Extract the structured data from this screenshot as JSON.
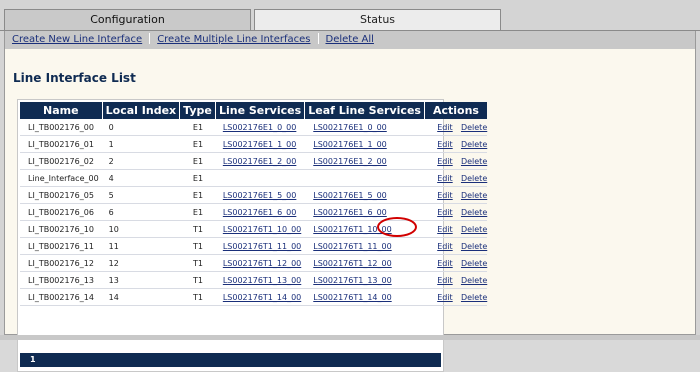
{
  "tabs": [
    {
      "label": "Configuration",
      "active": true
    },
    {
      "label": "Status",
      "active": false
    }
  ],
  "toolbar": {
    "links": [
      "Create New Line Interface",
      "Create Multiple Line Interfaces",
      "Delete All"
    ]
  },
  "page_title": "Line Interface List",
  "table": {
    "headers": [
      "Name",
      "Local Index",
      "Type",
      "Line Services",
      "Leaf Line Services",
      "Actions"
    ],
    "rows": [
      {
        "name": "LI_TB002176_00",
        "index": "0",
        "type": "E1",
        "ls": "LS002176E1_0_00",
        "lls": "LS002176E1_0_00",
        "edit": "Edit",
        "delete": "Delete"
      },
      {
        "name": "LI_TB002176_01",
        "index": "1",
        "type": "E1",
        "ls": "LS002176E1_1_00",
        "lls": "LS002176E1_1_00",
        "edit": "Edit",
        "delete": "Delete"
      },
      {
        "name": "LI_TB002176_02",
        "index": "2",
        "type": "E1",
        "ls": "LS002176E1_2_00",
        "lls": "LS002176E1_2_00",
        "edit": "Edit",
        "delete": "Delete"
      },
      {
        "name": "Line_Interface_00",
        "index": "4",
        "type": "E1",
        "ls": "",
        "lls": "",
        "edit": "Edit",
        "delete": "Delete"
      },
      {
        "name": "LI_TB002176_05",
        "index": "5",
        "type": "E1",
        "ls": "LS002176E1_5_00",
        "lls": "LS002176E1_5_00",
        "edit": "Edit",
        "delete": "Delete"
      },
      {
        "name": "LI_TB002176_06",
        "index": "6",
        "type": "E1",
        "ls": "LS002176E1_6_00",
        "lls": "LS002176E1_6_00",
        "edit": "Edit",
        "delete": "Delete"
      },
      {
        "name": "LI_TB002176_10",
        "index": "10",
        "type": "T1",
        "ls": "LS002176T1_10_00",
        "lls": "LS002176T1_10_00",
        "edit": "Edit",
        "delete": "Delete"
      },
      {
        "name": "LI_TB002176_11",
        "index": "11",
        "type": "T1",
        "ls": "LS002176T1_11_00",
        "lls": "LS002176T1_11_00",
        "edit": "Edit",
        "delete": "Delete"
      },
      {
        "name": "LI_TB002176_12",
        "index": "12",
        "type": "T1",
        "ls": "LS002176T1_12_00",
        "lls": "LS002176T1_12_00",
        "edit": "Edit",
        "delete": "Delete"
      },
      {
        "name": "LI_TB002176_13",
        "index": "13",
        "type": "T1",
        "ls": "LS002176T1_13_00",
        "lls": "LS002176T1_13_00",
        "edit": "Edit",
        "delete": "Delete"
      },
      {
        "name": "LI_TB002176_14",
        "index": "14",
        "type": "T1",
        "ls": "LS002176T1_14_00",
        "lls": "LS002176T1_14_00",
        "edit": "Edit",
        "delete": "Delete"
      }
    ]
  },
  "pagination": {
    "current_page": "1"
  },
  "colors": {
    "header_bg": "#0f2b52",
    "link": "#1a2f7a",
    "highlight_circle": "#d10000",
    "content_bg": "#fbf8ee"
  }
}
